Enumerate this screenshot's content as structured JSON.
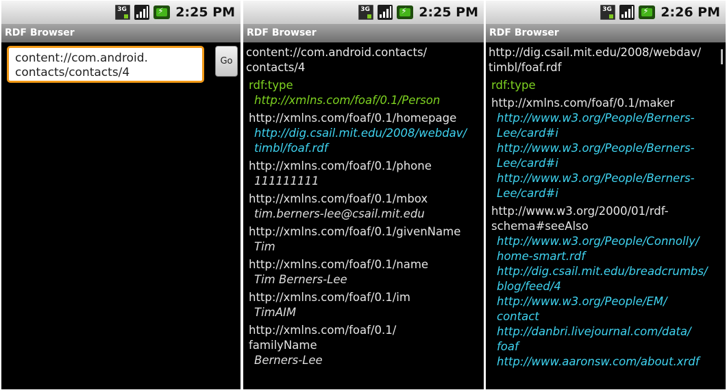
{
  "status_time": [
    "2:25 PM",
    "2:25 PM",
    "2:26 PM"
  ],
  "app_title": "RDF Browser",
  "screen1": {
    "url_value": [
      "content://com.android.",
      "contacts/contacts/4"
    ],
    "go_label": "Go"
  },
  "screen2": {
    "subject": [
      "content://com.android.contacts/",
      "contacts/4"
    ],
    "triples": [
      {
        "pred": [
          "rdf:type"
        ],
        "type": true,
        "objs": [
          {
            "lines": [
              "http://xmlns.com/foaf/0.1/Person"
            ],
            "kind": "green"
          }
        ]
      },
      {
        "pred": [
          "http://xmlns.com/foaf/0.1/homepage"
        ],
        "objs": [
          {
            "lines": [
              "http://dig.csail.mit.edu/2008/webdav/",
              "timbl/foaf.rdf"
            ],
            "kind": "uri"
          }
        ]
      },
      {
        "pred": [
          "http://xmlns.com/foaf/0.1/phone"
        ],
        "objs": [
          {
            "lines": [
              "111111111"
            ],
            "kind": "lit"
          }
        ]
      },
      {
        "pred": [
          "http://xmlns.com/foaf/0.1/mbox"
        ],
        "objs": [
          {
            "lines": [
              "tim.berners-lee@csail.mit.edu"
            ],
            "kind": "lit"
          }
        ]
      },
      {
        "pred": [
          "http://xmlns.com/foaf/0.1/givenName"
        ],
        "objs": [
          {
            "lines": [
              "Tim"
            ],
            "kind": "lit"
          }
        ]
      },
      {
        "pred": [
          "http://xmlns.com/foaf/0.1/name"
        ],
        "objs": [
          {
            "lines": [
              "Tim Berners-Lee"
            ],
            "kind": "lit"
          }
        ]
      },
      {
        "pred": [
          "http://xmlns.com/foaf/0.1/im"
        ],
        "objs": [
          {
            "lines": [
              "TimAIM"
            ],
            "kind": "lit"
          }
        ]
      },
      {
        "pred": [
          "http://xmlns.com/foaf/0.1/",
          "familyName"
        ],
        "objs": [
          {
            "lines": [
              "Berners-Lee"
            ],
            "kind": "lit"
          }
        ]
      }
    ]
  },
  "screen3": {
    "subject": [
      "http://dig.csail.mit.edu/2008/webdav/",
      "timbl/foaf.rdf"
    ],
    "triples": [
      {
        "pred": [
          "rdf:type"
        ],
        "type": true,
        "objs": []
      },
      {
        "pred": [
          "http://xmlns.com/foaf/0.1/maker"
        ],
        "objs": [
          {
            "lines": [
              "http://www.w3.org/People/Berners-",
              "Lee/card#i"
            ],
            "kind": "uri"
          },
          {
            "lines": [
              "http://www.w3.org/People/Berners-",
              "Lee/card#i"
            ],
            "kind": "uri"
          },
          {
            "lines": [
              "http://www.w3.org/People/Berners-",
              "Lee/card#i"
            ],
            "kind": "uri"
          }
        ]
      },
      {
        "pred": [
          "http://www.w3.org/2000/01/rdf-",
          "schema#seeAlso"
        ],
        "objs": [
          {
            "lines": [
              "http://www.w3.org/People/Connolly/",
              "home-smart.rdf"
            ],
            "kind": "uri"
          },
          {
            "lines": [
              "http://dig.csail.mit.edu/breadcrumbs/",
              "blog/feed/4"
            ],
            "kind": "uri"
          },
          {
            "lines": [
              "http://www.w3.org/People/EM/",
              "contact"
            ],
            "kind": "uri"
          },
          {
            "lines": [
              "http://danbri.livejournal.com/data/",
              "foaf"
            ],
            "kind": "uri"
          },
          {
            "lines": [
              "http://www.aaronsw.com/about.xrdf"
            ],
            "kind": "uri"
          }
        ]
      }
    ]
  }
}
